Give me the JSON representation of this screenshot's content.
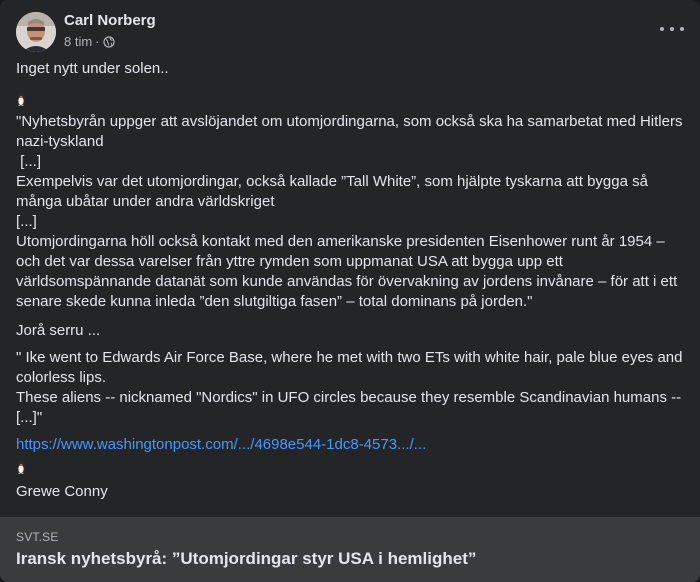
{
  "post": {
    "author": "Carl Norberg",
    "time": "8 tim",
    "separator": "·",
    "audience_icon": "globe-icon",
    "menu_icon": "more-horizontal-icon"
  },
  "body": {
    "intro": "Inget nytt under solen..",
    "quote1": [
      "\"Nyhetsbyrån uppger att avslöjandet om utomjordingarna, som också ska ha samarbetat med Hitlers nazi-tyskland",
      " [...]",
      "Exempelvis var det utomjordingar, också kallade ”Tall White”, som hjälpte tyskarna att bygga så många ubåtar under andra världskriget",
      "[...]",
      "Utomjordingarna höll också kontakt med den amerikanske presidenten Eisenhower runt år 1954 – och det var dessa varelser från yttre rymden som uppmanat USA att bygga upp ett världsomspännande datanät som kunde användas för övervakning av jordens invånare – för att i ett senare skede kunna inleda ”den slutgiltiga fasen” – total dominans på jorden.\""
    ],
    "remark": "Jorå serru ...",
    "quote2": [
      "\" Ike went to Edwards Air Force Base, where he met with two ETs with white hair, pale blue eyes and colorless lips.",
      "These aliens -- nicknamed \"Nordics\" in UFO circles because they resemble Scandinavian humans -- [...]\""
    ],
    "link": "https://www.washingtonpost.com/.../4698e544-1dc8-4573.../...",
    "signature": "Grewe Conny"
  },
  "preview": {
    "domain": "SVT.SE",
    "title": "Iransk nyhetsbyrå: ”Utomjordingar styr USA i hemlighet”"
  },
  "colors": {
    "card_bg": "#242526",
    "text": "#e4e6eb",
    "secondary": "#b0b3b8",
    "link": "#4599ff",
    "preview_bg": "#3a3b3c"
  }
}
